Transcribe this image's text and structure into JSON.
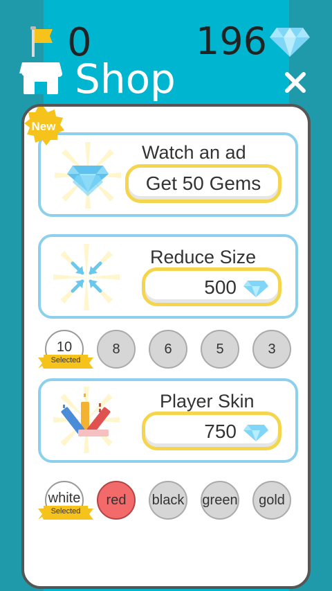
{
  "header": {
    "level_count": "0",
    "gem_count": "196",
    "title": "Shop"
  },
  "colors": {
    "background": "#1f9aaa",
    "center_strip": "#00b5d0",
    "card_border": "#8dd0ec",
    "button_border": "#f4d64e",
    "gem": "#7fd6f7",
    "new_badge": "#f6c21c"
  },
  "cards": {
    "ad": {
      "badge": "New",
      "title": "Watch an ad",
      "button_label": "Get 50 Gems"
    },
    "reduce": {
      "title": "Reduce Size",
      "price": "500"
    },
    "skin": {
      "title": "Player Skin",
      "price": "750"
    }
  },
  "size_options": {
    "selected_label": "Selected",
    "items": [
      "10",
      "8",
      "6",
      "5",
      "3"
    ],
    "selected": "10"
  },
  "skin_options": {
    "selected_label": "Selected",
    "items": [
      "white",
      "red",
      "black",
      "green",
      "gold"
    ],
    "selected": "white"
  }
}
